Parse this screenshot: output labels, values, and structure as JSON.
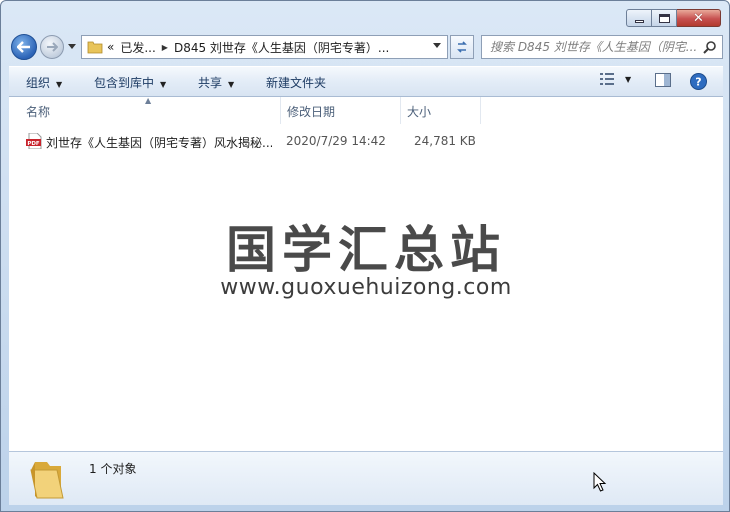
{
  "window": {
    "minimize_icon": "minimize-icon",
    "maximize_icon": "maximize-icon",
    "close_icon": "close-icon"
  },
  "navbar": {
    "breadcrumb": [
      {
        "label": "«"
      },
      {
        "label": "已发..."
      },
      {
        "label": "D845 刘世存《人生基因（阴宅专著）..."
      }
    ],
    "search_placeholder": "搜索 D845 刘世存《人生基因（阴宅..."
  },
  "toolbar": {
    "organize": "组织",
    "include_in_library": "包含到库中",
    "share": "共享",
    "new_folder": "新建文件夹"
  },
  "columns": {
    "name": "名称",
    "date_modified": "修改日期",
    "size": "大小"
  },
  "files": [
    {
      "name": "刘世存《人生基因（阴宅专著）风水揭秘...",
      "date": "2020/7/29 14:42",
      "size": "24,781 KB",
      "icon": "pdf-file-icon"
    }
  ],
  "watermark": {
    "title": "国学汇总站",
    "url": "www.guoxuehuizong.com"
  },
  "details": {
    "count": "1 个对象"
  }
}
